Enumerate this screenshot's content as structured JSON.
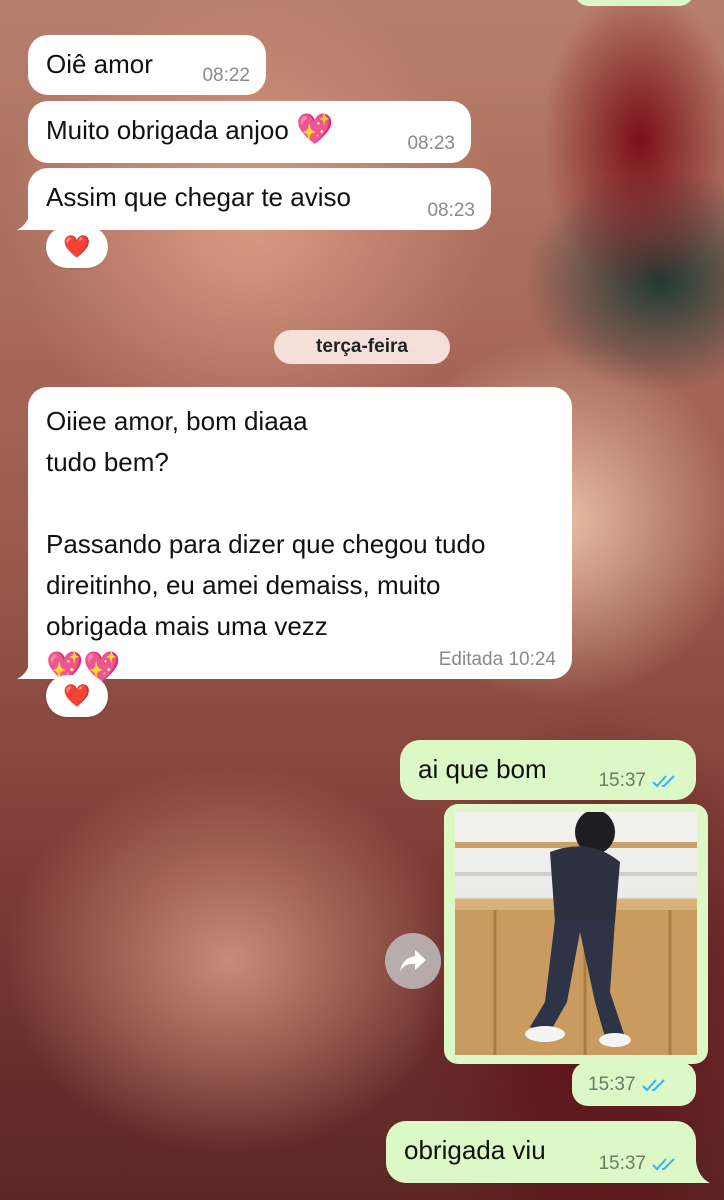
{
  "messages": {
    "m1": {
      "text": "Oiê amor",
      "time": "08:22"
    },
    "m2": {
      "text": "Muito obrigada anjoo",
      "emoji": "💖",
      "time": "08:23"
    },
    "m3": {
      "text": "Assim que chegar te aviso",
      "time": "08:23",
      "reaction": "❤️"
    },
    "date_separator": "terça-feira",
    "m4": {
      "line1": "Oiiee amor, bom diaaa",
      "line2": "tudo bem?",
      "line3": "Passando para dizer que chegou tudo",
      "line4": "direitinho, eu amei demaiss, muito",
      "line5": "obrigada mais uma vezz",
      "emoji": "💖💖",
      "time": "Editada 10:24",
      "reaction": "❤️"
    },
    "m5": {
      "text": "ai que bom",
      "time": "15:37"
    },
    "m6": {
      "time": "15:37"
    },
    "m7": {
      "text": "obrigada viu",
      "time": "15:37"
    }
  },
  "colors": {
    "incoming_bubble": "#ffffff",
    "outgoing_bubble": "#dcf8c6",
    "read_ticks": "#34b7f1"
  },
  "icons": {
    "forward": "forward-icon",
    "read_receipt": "double-check-icon",
    "reaction_heart": "heart-icon"
  }
}
